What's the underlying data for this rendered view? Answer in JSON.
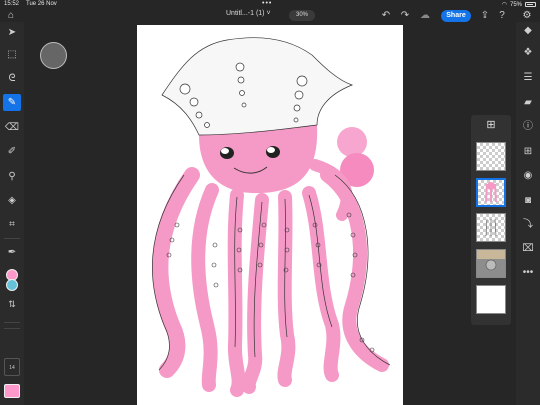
{
  "status": {
    "time": "15:52",
    "date": "Tue 26 Nov",
    "battery": "75%"
  },
  "document": {
    "title": "Untitl...-1 (1)",
    "zoom": "30%"
  },
  "toolbar": {
    "share_label": "Share"
  },
  "left_tools": [
    {
      "name": "select-tool",
      "icon": "arrow-icon",
      "glyph": "➤"
    },
    {
      "name": "transform-tool",
      "icon": "transform-icon",
      "glyph": "⬚"
    },
    {
      "name": "lasso-tool",
      "icon": "lasso-icon",
      "glyph": "ᘓ"
    },
    {
      "name": "brush-tool",
      "icon": "brush-icon",
      "glyph": "✎",
      "active": true
    },
    {
      "name": "eraser-tool",
      "icon": "eraser-icon",
      "glyph": "⌫"
    },
    {
      "name": "smudge-tool",
      "icon": "smudge-icon",
      "glyph": "✐"
    },
    {
      "name": "clone-tool",
      "icon": "clone-stamp-icon",
      "glyph": "⚲"
    },
    {
      "name": "fill-tool",
      "icon": "paint-bucket-icon",
      "glyph": "◈"
    },
    {
      "name": "crop-tool",
      "icon": "crop-icon",
      "glyph": "⌗"
    },
    {
      "name": "eyedropper-tool",
      "icon": "eyedropper-icon",
      "glyph": "✒"
    }
  ],
  "colors": {
    "primary": "#ff99cc",
    "secondary": "#66c2d9",
    "accent": "#1473e6",
    "pink": "#f59ac6"
  },
  "brush_size": "14",
  "layers": {
    "count": 5,
    "selected_index": 1
  }
}
